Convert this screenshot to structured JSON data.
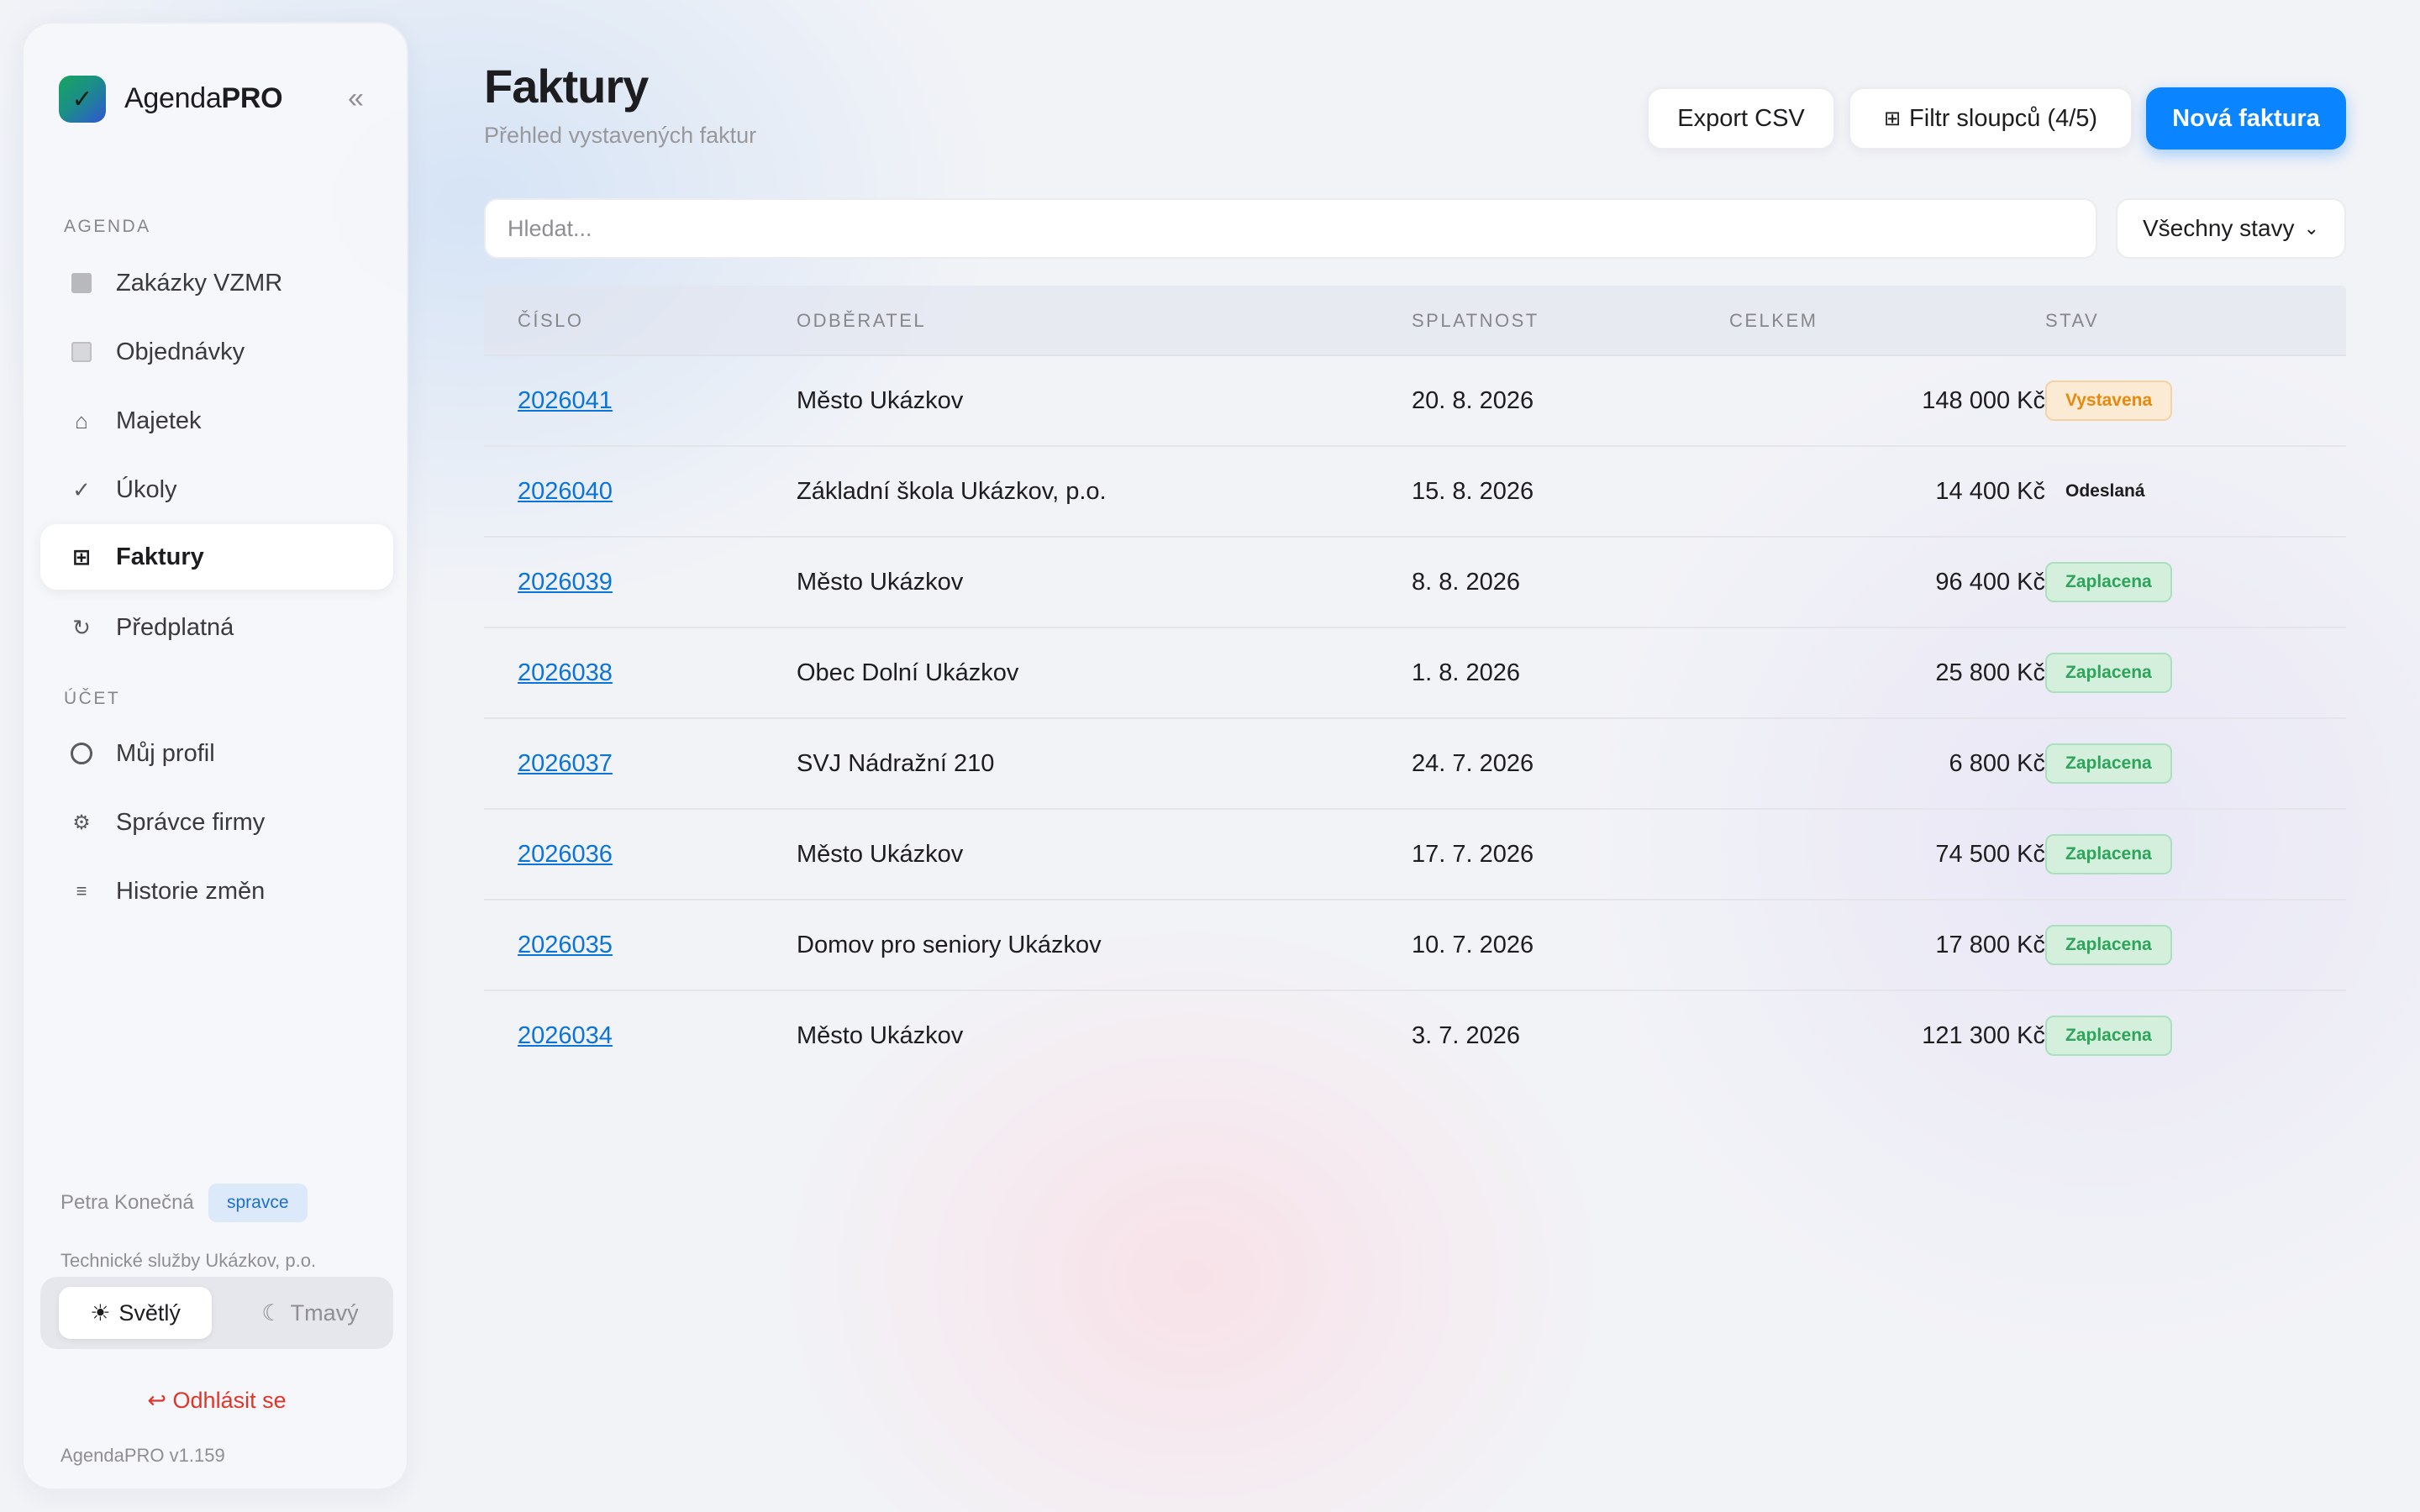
{
  "sidebar": {
    "brand_plain": "Agenda",
    "brand_bold": "PRO",
    "collapse_icon": "«",
    "section_agenda": "AGENDA",
    "section_account": "ÚČET",
    "items": [
      {
        "label": "Zakázky VZMR",
        "icon": "square-filled-icon"
      },
      {
        "label": "Objednávky",
        "icon": "square-outline-icon"
      },
      {
        "label": "Majetek",
        "icon": "home-icon"
      },
      {
        "label": "Úkoly",
        "icon": "check-icon"
      },
      {
        "label": "Faktury",
        "icon": "grid-icon",
        "active": true
      },
      {
        "label": "Předplatná",
        "icon": "refresh-icon"
      },
      {
        "label": "Můj profil",
        "icon": "circle-icon"
      },
      {
        "label": "Správce firmy",
        "icon": "gear-icon"
      },
      {
        "label": "Historie změn",
        "icon": "list-icon"
      }
    ],
    "user_name": "Petra Konečná",
    "role": "spravce",
    "company": "Technické služby Ukázkov, p.o.",
    "theme_light": "Světlý",
    "theme_dark": "Tmavý",
    "logout": "Odhlásit se",
    "version": "AgendaPRO v1.159"
  },
  "header": {
    "title": "Faktury",
    "subtitle": "Přehled vystavených faktur",
    "export_label": "Export CSV",
    "filter_label": "Filtr sloupců (4/5)",
    "new_label": "Nová faktura"
  },
  "search": {
    "placeholder": "Hledat..."
  },
  "status_filter": {
    "selected": "Všechny stavy"
  },
  "table": {
    "columns": [
      "ČÍSLO",
      "ODBĚRATEL",
      "SPLATNOST",
      "CELKEM",
      "STAV"
    ],
    "rows": [
      {
        "number": "2026041",
        "customer": "Město Ukázkov",
        "due": "20. 8. 2026",
        "total": "148 000 Kč",
        "status": "Vystavena",
        "status_type": "orange"
      },
      {
        "number": "2026040",
        "customer": "Základní škola Ukázkov, p.o.",
        "due": "15. 8. 2026",
        "total": "14 400 Kč",
        "status": "Odeslaná",
        "status_type": "plain"
      },
      {
        "number": "2026039",
        "customer": "Město Ukázkov",
        "due": "8. 8. 2026",
        "total": "96 400 Kč",
        "status": "Zaplacena",
        "status_type": "green"
      },
      {
        "number": "2026038",
        "customer": "Obec Dolní Ukázkov",
        "due": "1. 8. 2026",
        "total": "25 800 Kč",
        "status": "Zaplacena",
        "status_type": "green"
      },
      {
        "number": "2026037",
        "customer": "SVJ Nádražní 210",
        "due": "24. 7. 2026",
        "total": "6 800 Kč",
        "status": "Zaplacena",
        "status_type": "green"
      },
      {
        "number": "2026036",
        "customer": "Město Ukázkov",
        "due": "17. 7. 2026",
        "total": "74 500 Kč",
        "status": "Zaplacena",
        "status_type": "green"
      },
      {
        "number": "2026035",
        "customer": "Domov pro seniory Ukázkov",
        "due": "10. 7. 2026",
        "total": "17 800 Kč",
        "status": "Zaplacena",
        "status_type": "green"
      },
      {
        "number": "2026034",
        "customer": "Město Ukázkov",
        "due": "3. 7. 2026",
        "total": "121 300 Kč",
        "status": "Zaplacena",
        "status_type": "green"
      }
    ]
  },
  "colors": {
    "accent": "#0a84ff",
    "paid": "#2ca55a",
    "issued": "#e8890c",
    "logout": "#e0352b"
  }
}
